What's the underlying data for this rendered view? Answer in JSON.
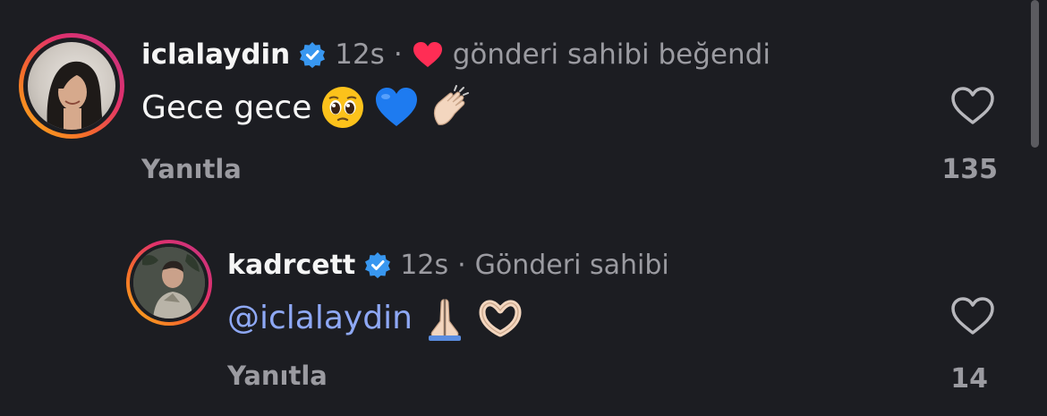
{
  "colors": {
    "background": "#1c1d22",
    "text_primary": "#f5f5f5",
    "text_secondary": "#9b9ba1",
    "mention": "#8ea8f5",
    "verified_badge": "#3897f0",
    "liked_heart": "#ff2d55"
  },
  "comments": [
    {
      "username": "iclalaydin",
      "verified": true,
      "time": "12s",
      "separator": "·",
      "liked_by_author_icon": "red-heart-icon",
      "liked_by_author_text": "gönderi sahibi beğendi",
      "text": "Gece gece",
      "emojis": [
        "pleading-face-emoji",
        "blue-heart-emoji",
        "clapping-hands-emoji"
      ],
      "reply_label": "Yanıtla",
      "like_count": "135",
      "like_icon": "heart-outline-icon"
    },
    {
      "username": "kadrcett",
      "verified": true,
      "time": "12s",
      "separator": "·",
      "author_badge_text": "Gönderi sahibi",
      "mention": "@iclalaydin",
      "emojis": [
        "folded-hands-emoji",
        "heart-hands-emoji"
      ],
      "reply_label": "Yanıtla",
      "like_count": "14",
      "like_icon": "heart-outline-icon"
    }
  ]
}
